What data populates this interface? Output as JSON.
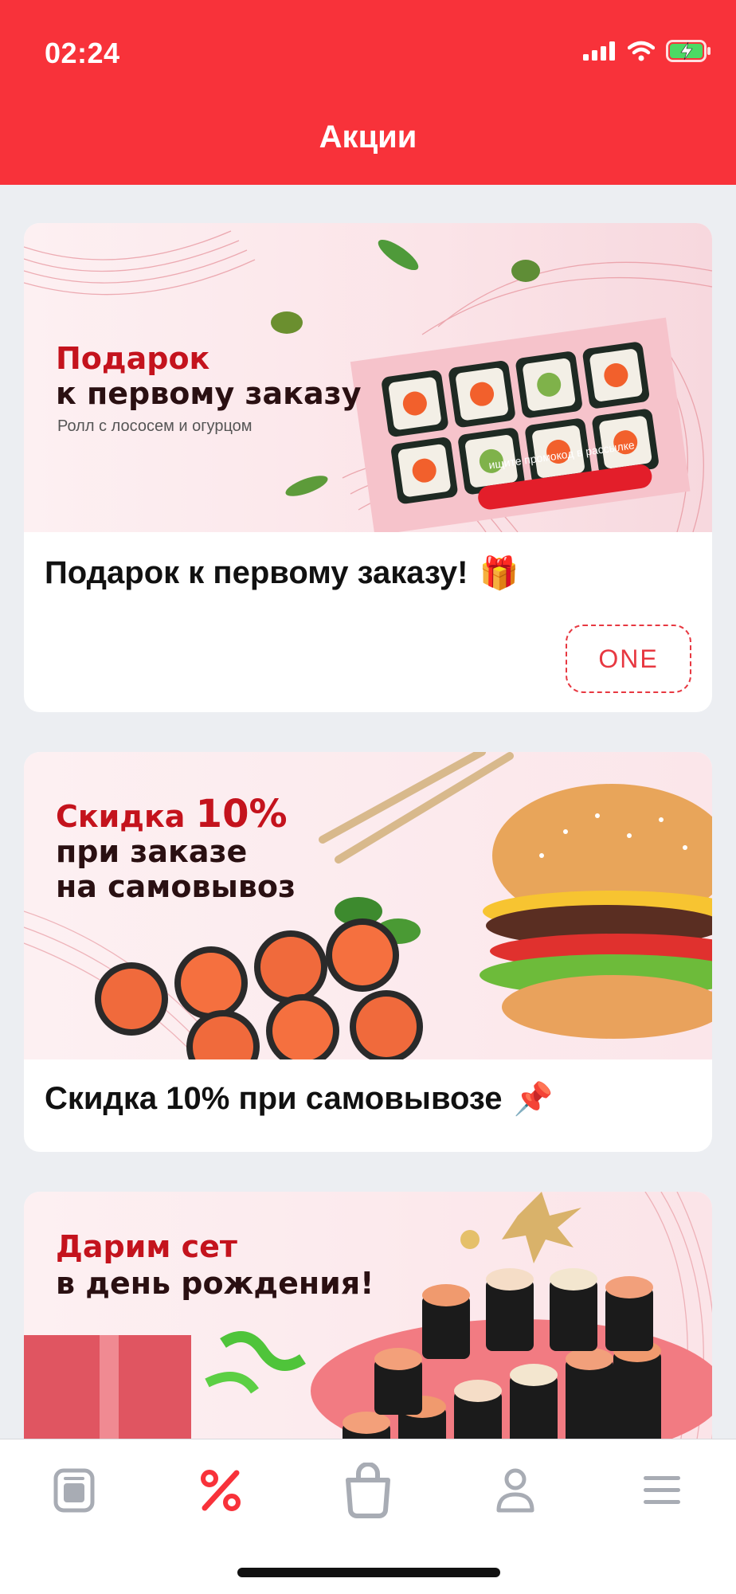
{
  "status_bar": {
    "time": "02:24"
  },
  "header": {
    "title": "Акции"
  },
  "cards": [
    {
      "banner_title_line1": "Подарок",
      "banner_title_line2": "к первому заказу",
      "banner_subtitle": "Ролл с лососем и огурцом",
      "banner_badge": "ищите промокод в рассылке",
      "title": "Подарок к первому заказу!",
      "emoji": "🎁",
      "promo_code": "ONE"
    },
    {
      "banner_line1_text": "Скидка",
      "banner_line1_percent": "10%",
      "banner_line2": "при заказе",
      "banner_line3": "на самовывоз",
      "title": "Скидка 10% при самовывозе",
      "emoji": "📌"
    },
    {
      "banner_line1": "Дарим сет",
      "banner_line2": "в день рождения!"
    }
  ],
  "tabbar": {
    "items": [
      {
        "icon": "menu-card-icon",
        "active": false
      },
      {
        "icon": "percent-icon",
        "active": true
      },
      {
        "icon": "bag-icon",
        "active": false
      },
      {
        "icon": "profile-icon",
        "active": false
      },
      {
        "icon": "hamburger-icon",
        "active": false
      }
    ],
    "active_color": "#f8323a",
    "inactive_color": "#a8acb4"
  },
  "colors": {
    "accent": "#f8323a",
    "background": "#eceef2"
  }
}
